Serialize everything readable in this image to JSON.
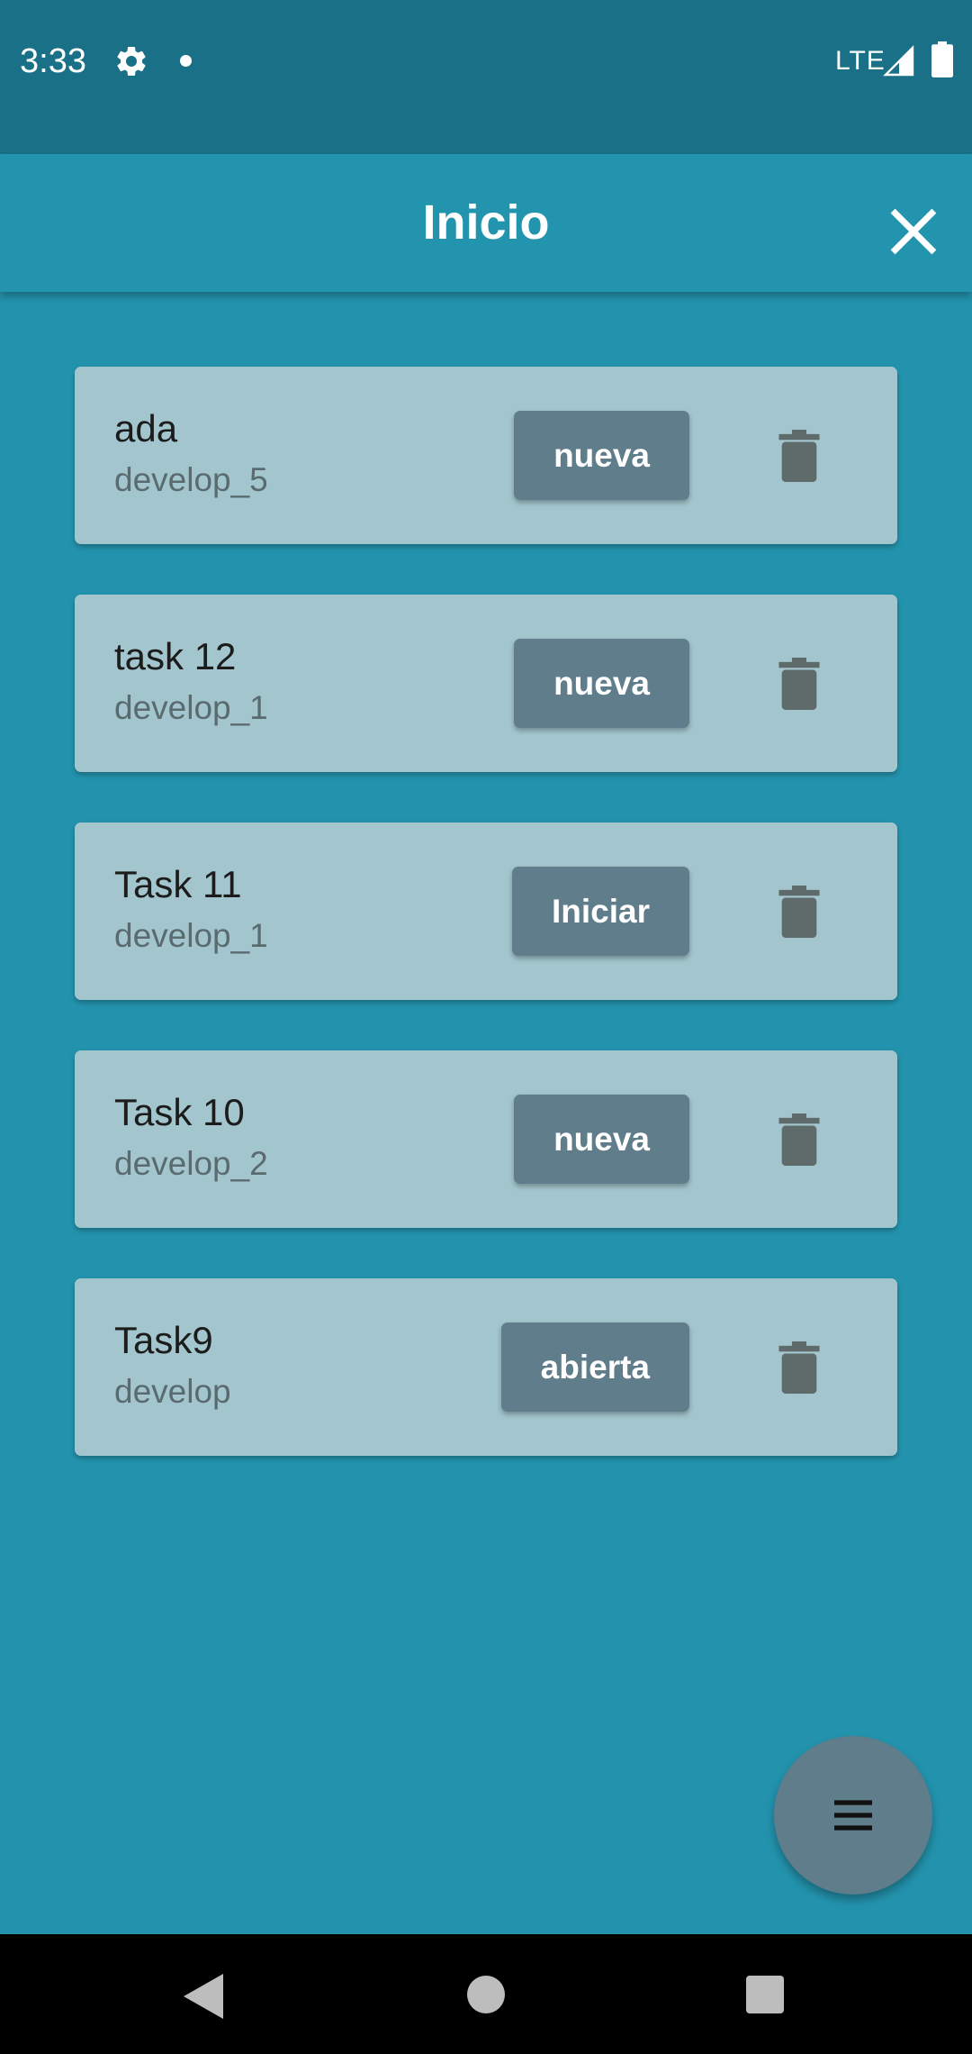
{
  "status_bar": {
    "time": "3:33",
    "network": "LTE",
    "icons": [
      "gear-icon",
      "notification-dot-icon",
      "signal-icon",
      "battery-icon"
    ]
  },
  "app_bar": {
    "title": "Inicio",
    "close_icon": "close-icon"
  },
  "tasks": [
    {
      "title": "ada",
      "subtitle": "develop_5",
      "status_label": "nueva",
      "delete_icon": "trash-icon"
    },
    {
      "title": "task 12",
      "subtitle": "develop_1",
      "status_label": "nueva",
      "delete_icon": "trash-icon"
    },
    {
      "title": "Task 11",
      "subtitle": "develop_1",
      "status_label": "Iniciar",
      "delete_icon": "trash-icon"
    },
    {
      "title": "Task 10",
      "subtitle": "develop_2",
      "status_label": "nueva",
      "delete_icon": "trash-icon"
    },
    {
      "title": "Task9",
      "subtitle": "develop",
      "status_label": "abierta",
      "delete_icon": "trash-icon"
    }
  ],
  "fab": {
    "icon": "menu-icon"
  },
  "nav_bar": {
    "icons": [
      "back-icon",
      "home-icon",
      "recents-icon"
    ]
  },
  "colors": {
    "background": "#2393ad",
    "status_bar": "#1a7087",
    "app_bar": "#2394ad",
    "card": "#a3c6ce",
    "button": "#607d8b",
    "icon_gray": "#5f6b6b"
  }
}
